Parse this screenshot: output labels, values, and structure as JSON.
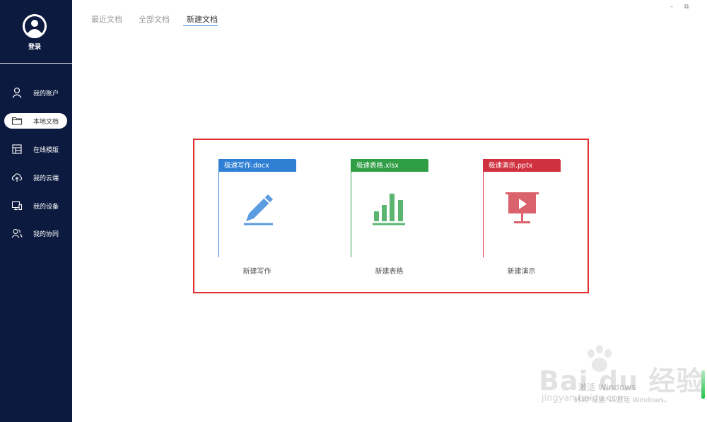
{
  "sidebar": {
    "login_label": "登录",
    "items": [
      {
        "label": "我的账户",
        "icon": "user-icon"
      },
      {
        "label": "本地文档",
        "icon": "folder-icon"
      },
      {
        "label": "在线模版",
        "icon": "template-icon"
      },
      {
        "label": "我的云端",
        "icon": "cloud-upload-icon"
      },
      {
        "label": "我的设备",
        "icon": "devices-icon"
      },
      {
        "label": "我的协同",
        "icon": "users-icon"
      }
    ],
    "active_index": 1,
    "background": "#0c1a3f"
  },
  "tabs": [
    {
      "label": "最近文档"
    },
    {
      "label": "全部文档"
    },
    {
      "label": "新建文档"
    }
  ],
  "active_tab": 2,
  "window_controls": {
    "minimize": "–",
    "restore": "⧉"
  },
  "docs": [
    {
      "title": "极速写作.docx",
      "caption": "新建写作",
      "color": "#2f7fd4",
      "icon_color": "#5b9be0",
      "icon": "pen-icon"
    },
    {
      "title": "极速表格.xlsx",
      "caption": "新建表格",
      "color": "#2f9e44",
      "icon_color": "#5bb570",
      "icon": "bar-chart-icon"
    },
    {
      "title": "极速演示.pptx",
      "caption": "新建演示",
      "color": "#d0313f",
      "icon_color": "#d9626c",
      "icon": "presentation-icon"
    }
  ],
  "highlight_color": "#e0302f",
  "watermark": {
    "brand": "Bai du 经验",
    "url": "jingyan.baidu.com",
    "activate_title": "激活 Windows",
    "activate_sub": "转到\"设置\"以激活 Windows。"
  }
}
